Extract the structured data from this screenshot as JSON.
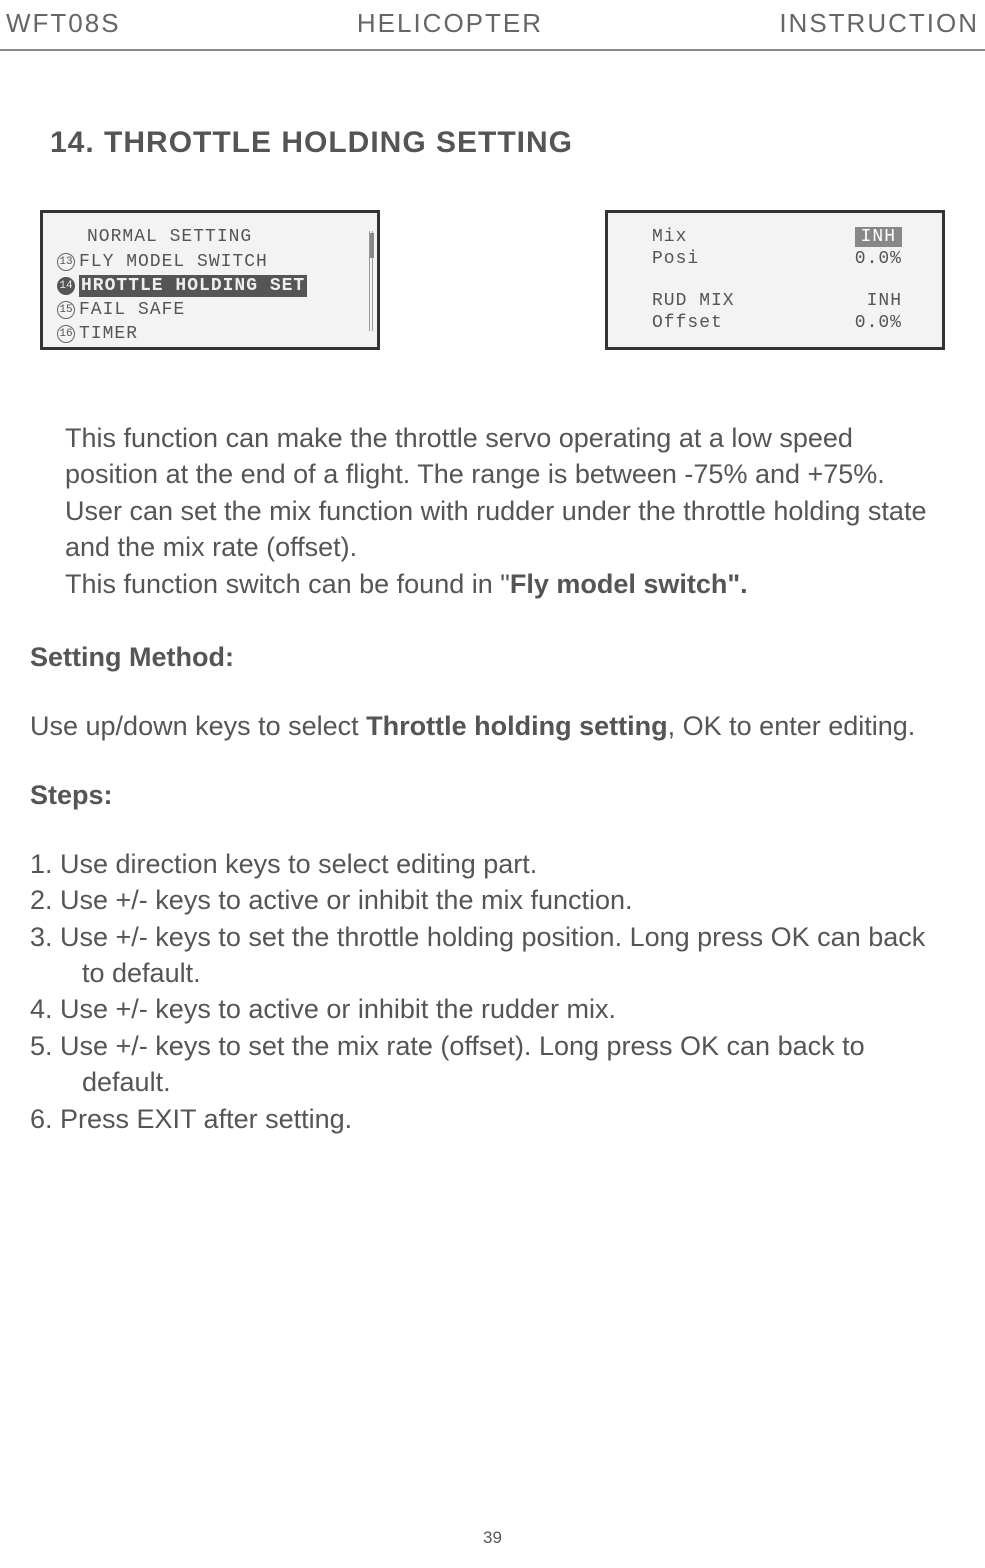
{
  "header": {
    "left": "WFT08S",
    "center": "HELICOPTER",
    "right": "INSTRUCTION"
  },
  "section_title": "14. THROTTLE HOLDING SETTING",
  "screen1": {
    "title": "NORMAL SETTING",
    "items": [
      {
        "num": "13",
        "text": "FLY MODEL SWITCH",
        "selected": false
      },
      {
        "num": "14",
        "text": "HROTTLE HOLDING SET",
        "selected": true
      },
      {
        "num": "15",
        "text": "FAIL SAFE",
        "selected": false
      },
      {
        "num": "16",
        "text": "TIMER",
        "selected": false
      }
    ]
  },
  "screen2": {
    "rows": [
      {
        "label": "Mix",
        "value": "INH",
        "highlighted": true
      },
      {
        "label": "Posi",
        "value": "0.0%",
        "highlighted": false
      },
      {
        "label": "",
        "value": "",
        "highlighted": false
      },
      {
        "label": "RUD MIX",
        "value": "INH",
        "highlighted": false
      },
      {
        "label": "Offset",
        "value": "0.0%",
        "highlighted": false
      }
    ]
  },
  "description": {
    "p1": "This function can make the throttle servo operating at a low speed position at the end of a flight. The range is between -75% and +75%.",
    "p2": "User can set the mix function with rudder under the throttle holding state and the mix rate (offset).",
    "p3a": "This function switch can be found in \"",
    "p3b": "Fly model switch",
    "p3c": "\"."
  },
  "setting_method_heading": "Setting Method:",
  "setting_method_text_a": "Use up/down keys to select ",
  "setting_method_text_b": "Throttle holding setting",
  "setting_method_text_c": ", OK to enter editing.",
  "steps_heading": "Steps:",
  "steps": [
    "1. Use direction keys to select editing part.",
    "2. Use +/- keys to active or inhibit the mix function.",
    "3. Use +/- keys to set the throttle holding position. Long press OK can back to default.",
    "4. Use +/- keys to active or inhibit the rudder mix.",
    "5. Use +/- keys to set the mix rate (offset). Long press OK can back to default.",
    "6. Press EXIT after setting."
  ],
  "page_number": "39"
}
